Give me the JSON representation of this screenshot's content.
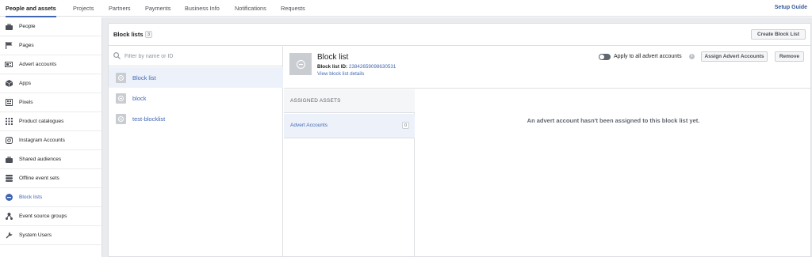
{
  "topnav": {
    "tabs": [
      {
        "label": "People and assets",
        "active": true
      },
      {
        "label": "Projects"
      },
      {
        "label": "Partners"
      },
      {
        "label": "Payments"
      },
      {
        "label": "Business Info"
      },
      {
        "label": "Notifications"
      },
      {
        "label": "Requests"
      }
    ],
    "setup_guide": "Setup Guide"
  },
  "sidebar": {
    "items": [
      {
        "label": "People",
        "icon": "briefcase-icon"
      },
      {
        "label": "Pages",
        "icon": "flag-icon"
      },
      {
        "label": "Advert accounts",
        "icon": "ad-account-icon"
      },
      {
        "label": "Apps",
        "icon": "cube-icon"
      },
      {
        "label": "Pixels",
        "icon": "pixel-icon"
      },
      {
        "label": "Product catalogues",
        "icon": "grid-icon"
      },
      {
        "label": "Instagram Accounts",
        "icon": "instagram-icon"
      },
      {
        "label": "Shared audiences",
        "icon": "briefcase-icon"
      },
      {
        "label": "Offline event sets",
        "icon": "database-icon"
      },
      {
        "label": "Block lists",
        "icon": "block-icon",
        "active": true
      },
      {
        "label": "Event source groups",
        "icon": "event-source-icon"
      },
      {
        "label": "System Users",
        "icon": "wrench-icon"
      }
    ]
  },
  "block_lists": {
    "title": "Block lists",
    "count": "3",
    "create_button": "Create Block List",
    "search_placeholder": "Filter by name or ID",
    "items": [
      "Block list",
      "block",
      "test-blocklist"
    ]
  },
  "detail": {
    "name": "Block list",
    "id_label": "Block list ID:",
    "id_value": "23842659098630531",
    "view_details": "View block list details",
    "apply_label": "Apply to all advert accounts",
    "apply_enabled": false,
    "assign_button": "Assign Advert Accounts",
    "remove_button": "Remove",
    "assigned_heading": "ASSIGNED ASSETS",
    "asset_type": "Advert Accounts",
    "asset_count": "0",
    "empty_message": "An advert account hasn't been assigned to this block list yet."
  },
  "colors": {
    "accent": "#4267b2",
    "link": "#365899",
    "content_bg": "#e9ebee",
    "selected_bg": "#edf2fa"
  }
}
